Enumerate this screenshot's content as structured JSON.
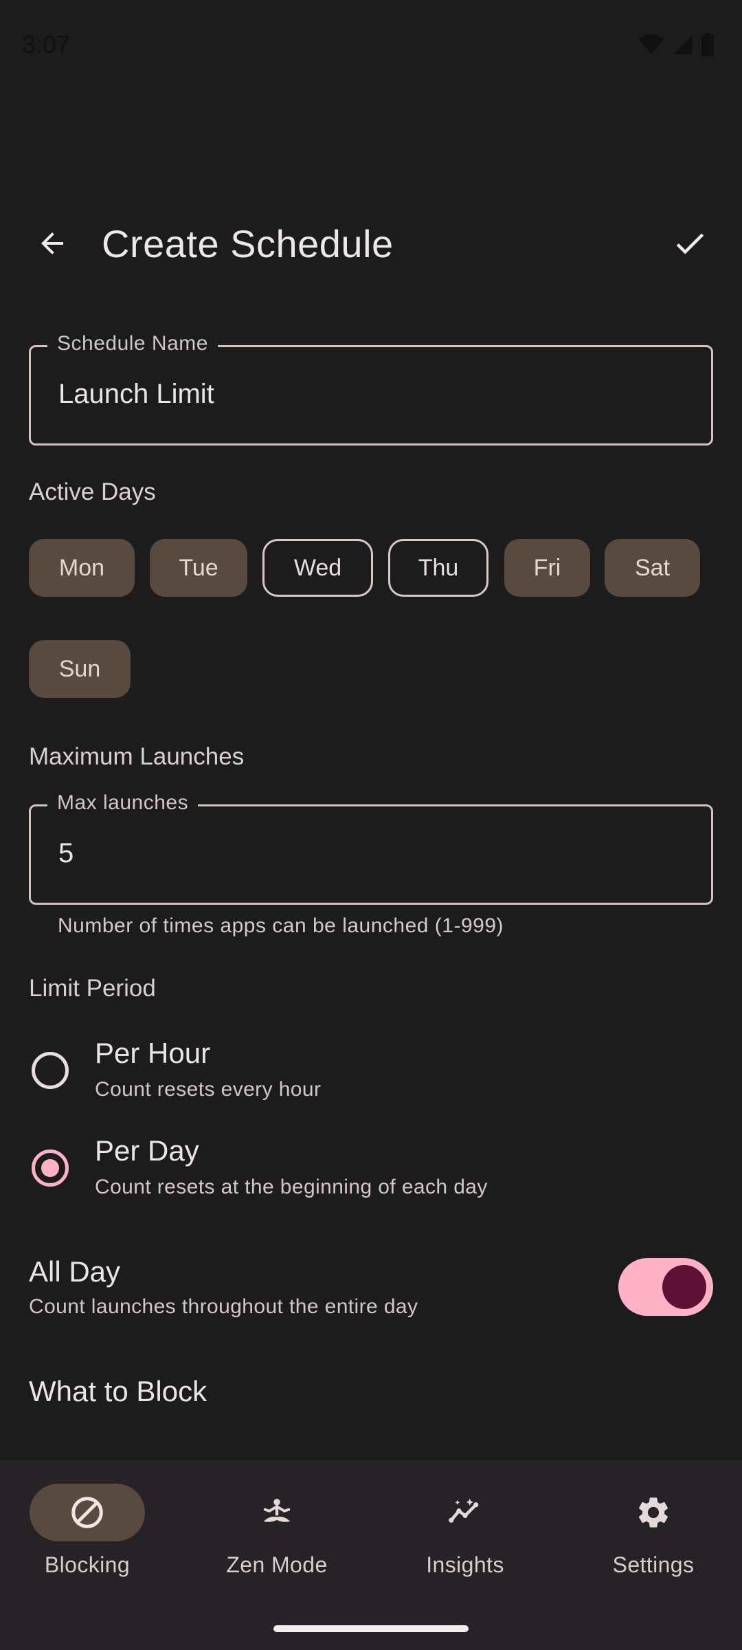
{
  "status_bar": {
    "time": "3:07"
  },
  "app_bar": {
    "title": "Create Schedule",
    "back_icon": "arrow-back-icon",
    "confirm_icon": "check-icon"
  },
  "schedule_name": {
    "label": "Schedule Name",
    "value": "Launch Limit"
  },
  "active_days": {
    "label": "Active Days",
    "days": [
      {
        "label": "Mon",
        "selected": true
      },
      {
        "label": "Tue",
        "selected": true
      },
      {
        "label": "Wed",
        "selected": false
      },
      {
        "label": "Thu",
        "selected": false
      },
      {
        "label": "Fri",
        "selected": true
      },
      {
        "label": "Sat",
        "selected": true
      },
      {
        "label": "Sun",
        "selected": true
      }
    ]
  },
  "maximum_launches": {
    "section_label": "Maximum Launches",
    "field_label": "Max launches",
    "value": "5",
    "helper": "Number of times apps can be launched (1-999)"
  },
  "limit_period": {
    "label": "Limit Period",
    "options": [
      {
        "title": "Per Hour",
        "subtitle": "Count resets every hour",
        "selected": false
      },
      {
        "title": "Per Day",
        "subtitle": "Count resets at the beginning of each day",
        "selected": true
      }
    ]
  },
  "all_day": {
    "title": "All Day",
    "subtitle": "Count launches throughout the entire day",
    "enabled": true
  },
  "what_to_block": {
    "title": "What to Block"
  },
  "bottom_nav": {
    "items": [
      {
        "label": "Blocking",
        "icon": "block-icon",
        "active": true
      },
      {
        "label": "Zen Mode",
        "icon": "meditation-icon",
        "active": false
      },
      {
        "label": "Insights",
        "icon": "insights-icon",
        "active": false
      },
      {
        "label": "Settings",
        "icon": "gear-icon",
        "active": false
      }
    ]
  },
  "colors": {
    "background": "#1d1c1d",
    "chip_selected": "#584a3e",
    "accent_pink": "#ffb1c6",
    "switch_thumb": "#5e1134",
    "nav_background": "#252327"
  }
}
